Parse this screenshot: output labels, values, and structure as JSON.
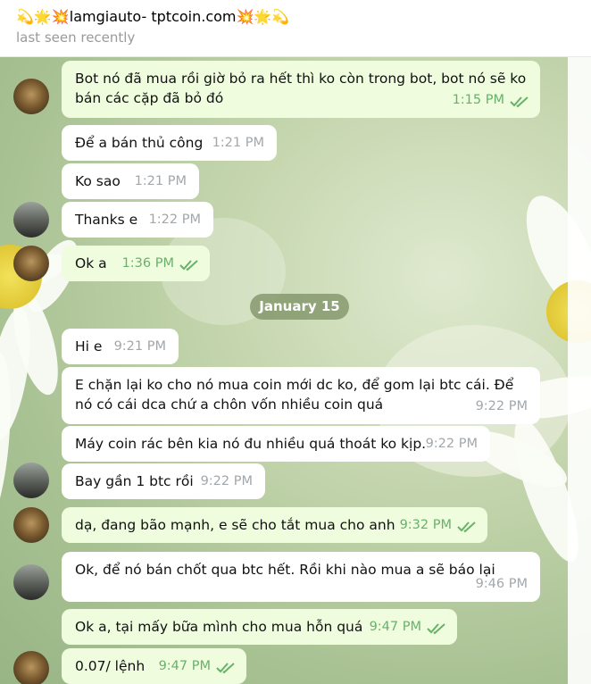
{
  "header": {
    "title": "💫🌟💥lamgiauto- tptcoin.com💥🌟💫",
    "status": "last seen recently"
  },
  "date_separator": "January 15",
  "messages": [
    {
      "text": "Bot nó đã mua rồi giờ bỏ ra hết thì ko còn trong bot, bot nó sẽ ko bán các cặp đã bỏ đó",
      "time": "1:15 PM",
      "direction": "out"
    },
    {
      "text": "Để a bán thủ công",
      "time": "1:21 PM",
      "direction": "in"
    },
    {
      "text": "Ko sao",
      "time": "1:21 PM",
      "direction": "in"
    },
    {
      "text": "Thanks e",
      "time": "1:22 PM",
      "direction": "in"
    },
    {
      "text": "Ok a",
      "time": "1:36 PM",
      "direction": "out"
    },
    {
      "text": "Hi e",
      "time": "9:21 PM",
      "direction": "in"
    },
    {
      "text": "E chặn lại ko cho nó mua coin mới dc ko, để gom lại btc cái. Để nó có cái dca chứ a chôn vốn nhiều coin quá",
      "time": "9:22 PM",
      "direction": "in"
    },
    {
      "text": "Máy coin rác bên kia nó đu nhiều quá thoát ko kịp.",
      "time": "9:22 PM",
      "direction": "in"
    },
    {
      "text": "Bay gần 1 btc rồi",
      "time": "9:22 PM",
      "direction": "in"
    },
    {
      "text": "dạ, đang bão mạnh, e sẽ cho tắt mua cho anh",
      "time": "9:32 PM",
      "direction": "out"
    },
    {
      "text": "Ok, để nó bán chốt qua btc hết. Rồi khi nào mua a sẽ báo lại",
      "time": "9:46 PM",
      "direction": "in"
    },
    {
      "text": "Ok a, tại mấy bữa mình cho mua hỗn quá",
      "time": "9:47 PM",
      "direction": "out"
    },
    {
      "text": "0.07/ lệnh",
      "time": "9:47 PM",
      "direction": "out"
    }
  ],
  "colors": {
    "outgoing_bubble": "#effdde",
    "incoming_bubble": "#ffffff",
    "read_check": "#69b16b"
  },
  "icons": {
    "read_receipt": "double-check-icon"
  }
}
